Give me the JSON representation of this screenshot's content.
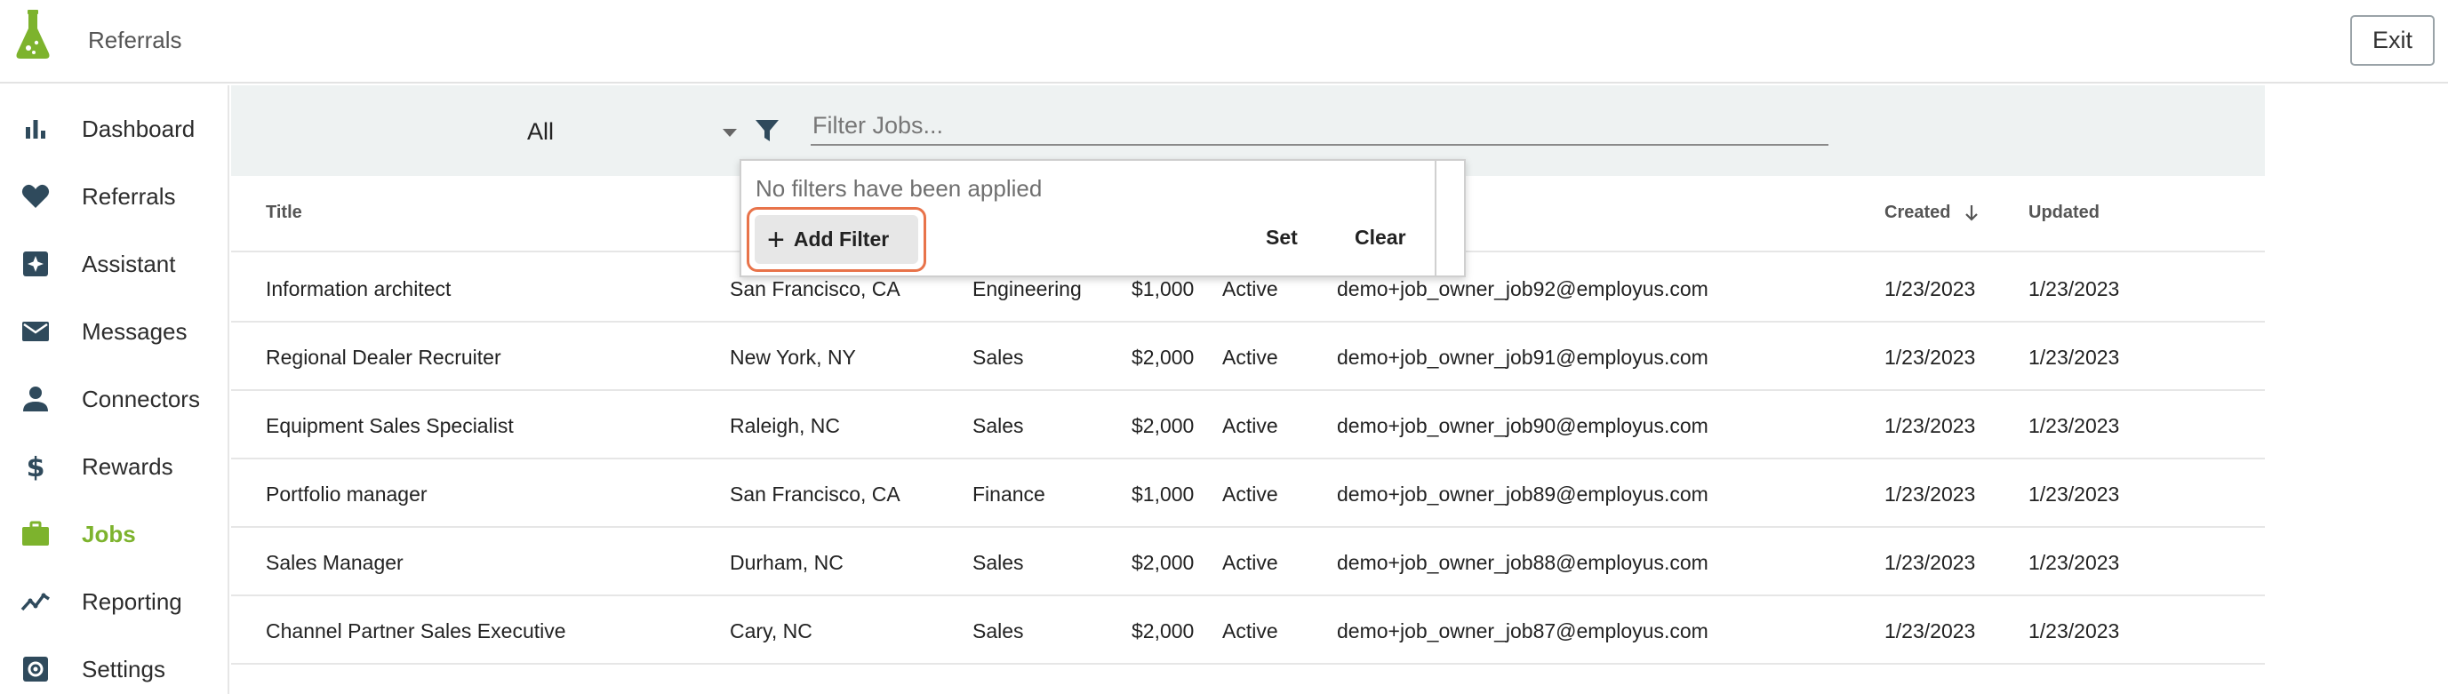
{
  "header": {
    "title": "Referrals",
    "exit_label": "Exit"
  },
  "sidebar": {
    "items": [
      {
        "label": "Dashboard",
        "icon": "bar-chart-icon"
      },
      {
        "label": "Referrals",
        "icon": "heart-icon"
      },
      {
        "label": "Assistant",
        "icon": "sparkle-icon"
      },
      {
        "label": "Messages",
        "icon": "envelope-icon"
      },
      {
        "label": "Connectors",
        "icon": "person-icon"
      },
      {
        "label": "Rewards",
        "icon": "dollar-icon"
      },
      {
        "label": "Jobs",
        "icon": "briefcase-icon",
        "active": true
      },
      {
        "label": "Reporting",
        "icon": "trend-icon"
      },
      {
        "label": "Settings",
        "icon": "gear-icon"
      }
    ]
  },
  "filters": {
    "status_value": "All",
    "search_placeholder": "Filter Jobs..."
  },
  "popover": {
    "message": "No filters have been applied",
    "add_filter_label": "Add Filter",
    "set_label": "Set",
    "clear_label": "Clear"
  },
  "table": {
    "headers": {
      "title": "Title",
      "created": "Created",
      "updated": "Updated"
    },
    "rows": [
      {
        "title": "Information architect",
        "location": "San Francisco, CA",
        "department": "Engineering",
        "reward": "$1,000",
        "status": "Active",
        "owner": "demo+job_owner_job92@employus.com",
        "created": "1/23/2023",
        "updated": "1/23/2023"
      },
      {
        "title": "Regional Dealer Recruiter",
        "location": "New York, NY",
        "department": "Sales",
        "reward": "$2,000",
        "status": "Active",
        "owner": "demo+job_owner_job91@employus.com",
        "created": "1/23/2023",
        "updated": "1/23/2023"
      },
      {
        "title": "Equipment Sales Specialist",
        "location": "Raleigh, NC",
        "department": "Sales",
        "reward": "$2,000",
        "status": "Active",
        "owner": "demo+job_owner_job90@employus.com",
        "created": "1/23/2023",
        "updated": "1/23/2023"
      },
      {
        "title": "Portfolio manager",
        "location": "San Francisco, CA",
        "department": "Finance",
        "reward": "$1,000",
        "status": "Active",
        "owner": "demo+job_owner_job89@employus.com",
        "created": "1/23/2023",
        "updated": "1/23/2023"
      },
      {
        "title": "Sales Manager",
        "location": "Durham, NC",
        "department": "Sales",
        "reward": "$2,000",
        "status": "Active",
        "owner": "demo+job_owner_job88@employus.com",
        "created": "1/23/2023",
        "updated": "1/23/2023"
      },
      {
        "title": "Channel Partner Sales Executive",
        "location": "Cary, NC",
        "department": "Sales",
        "reward": "$2,000",
        "status": "Active",
        "owner": "demo+job_owner_job87@employus.com",
        "created": "1/23/2023",
        "updated": "1/23/2023"
      }
    ]
  },
  "colors": {
    "accent": "#7db32d",
    "highlight_ring": "#e8734a",
    "icon": "#2f4a5c"
  }
}
